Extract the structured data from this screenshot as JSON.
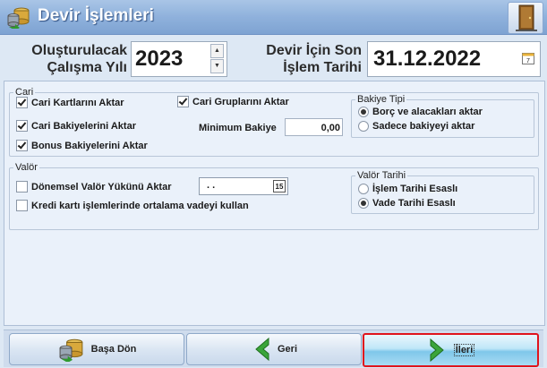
{
  "window": {
    "title": "Devir İşlemleri"
  },
  "header": {
    "year_label_line1": "Oluşturulacak",
    "year_label_line2": "Çalışma Yılı",
    "year_value": "2023",
    "date_label_line1": "Devir İçin Son",
    "date_label_line2": "İşlem Tarihi",
    "date_value": "31.12.2022",
    "date_icon_day": "7"
  },
  "cari": {
    "legend": "Cari",
    "cari_kartlari": {
      "label": "Cari Kartlarını Aktar",
      "checked": true
    },
    "cari_gruplari": {
      "label": "Cari Gruplarını Aktar",
      "checked": true
    },
    "cari_bakiyeleri": {
      "label": "Cari Bakiyelerini Aktar",
      "checked": true
    },
    "bonus_bakiyeleri": {
      "label": "Bonus Bakiyelerini Aktar",
      "checked": true
    },
    "min_bakiye_label": "Minimum Bakiye",
    "min_bakiye_value": "0,00",
    "bakiye_tipi": {
      "legend": "Bakiye Tipi",
      "options": [
        {
          "label": "Borç ve alacakları aktar",
          "selected": true
        },
        {
          "label": "Sadece bakiyeyi aktar",
          "selected": false
        }
      ]
    }
  },
  "valor": {
    "legend": "Valör",
    "donemsel": {
      "label": "Dönemsel Valör Yükünü Aktar",
      "checked": false
    },
    "kredi": {
      "label": "Kredi kartı işlemlerinde ortalama vadeyi kullan",
      "checked": false
    },
    "date_value": ". .",
    "date_icon_text": "15",
    "valor_tarihi": {
      "legend": "Valör Tarihi",
      "options": [
        {
          "label": "İşlem Tarihi Esaslı",
          "selected": false
        },
        {
          "label": "Vade Tarihi Esaslı",
          "selected": true
        }
      ]
    }
  },
  "footer": {
    "basa_don": "Başa Dön",
    "geri": "Geri",
    "ileri": "İleri"
  },
  "colors": {
    "accent": "#8fb1dc",
    "highlight_border": "#e0141c",
    "arrow_green": "#3aa53a"
  }
}
